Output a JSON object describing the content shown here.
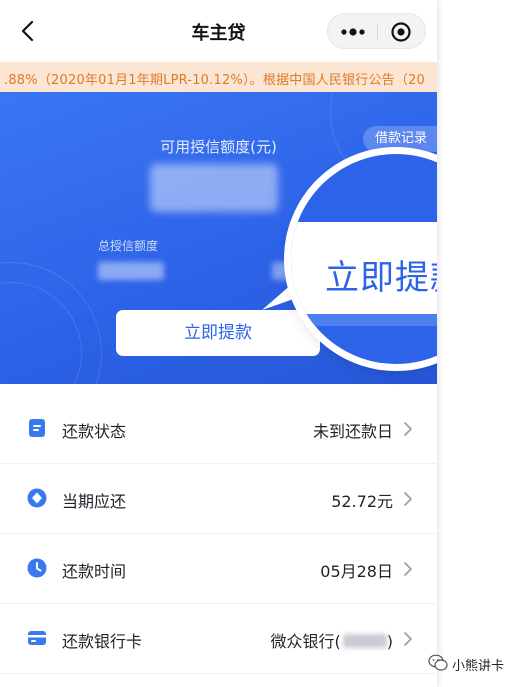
{
  "navbar": {
    "title": "车主贷",
    "back_icon": "chevron-left-icon",
    "more_icon": "more-dots-icon",
    "close_icon": "target-close-icon"
  },
  "notice": {
    "text": ".88%（2020年01月1年期LPR-10.12%）。根据中国人民银行公告（20"
  },
  "credit_card": {
    "records_label": "借款记录",
    "available_label": "可用授信额度(元)",
    "total_label": "总授信额度",
    "withdraw_button": "立即提款",
    "background_color": "#2d63e8"
  },
  "magnifier": {
    "text": "立即提款"
  },
  "list": [
    {
      "label": "还款状态",
      "value": "未到还款日",
      "icon": "document-icon"
    },
    {
      "label": "当期应还",
      "value": "52.72元",
      "icon": "diamond-badge-icon"
    },
    {
      "label": "还款时间",
      "value": "05月28日",
      "icon": "clock-icon"
    },
    {
      "label": "还款银行卡",
      "value_prefix": "微众银行(",
      "value_suffix": ")",
      "icon": "bank-card-icon"
    }
  ],
  "watermark": {
    "text": "小熊讲卡",
    "icon": "wechat-icon"
  },
  "colors": {
    "accent": "#2d63e8",
    "notice_text": "#e07a2a",
    "notice_bg": "#fbe6d4",
    "icon_blue": "#3a78f2"
  }
}
